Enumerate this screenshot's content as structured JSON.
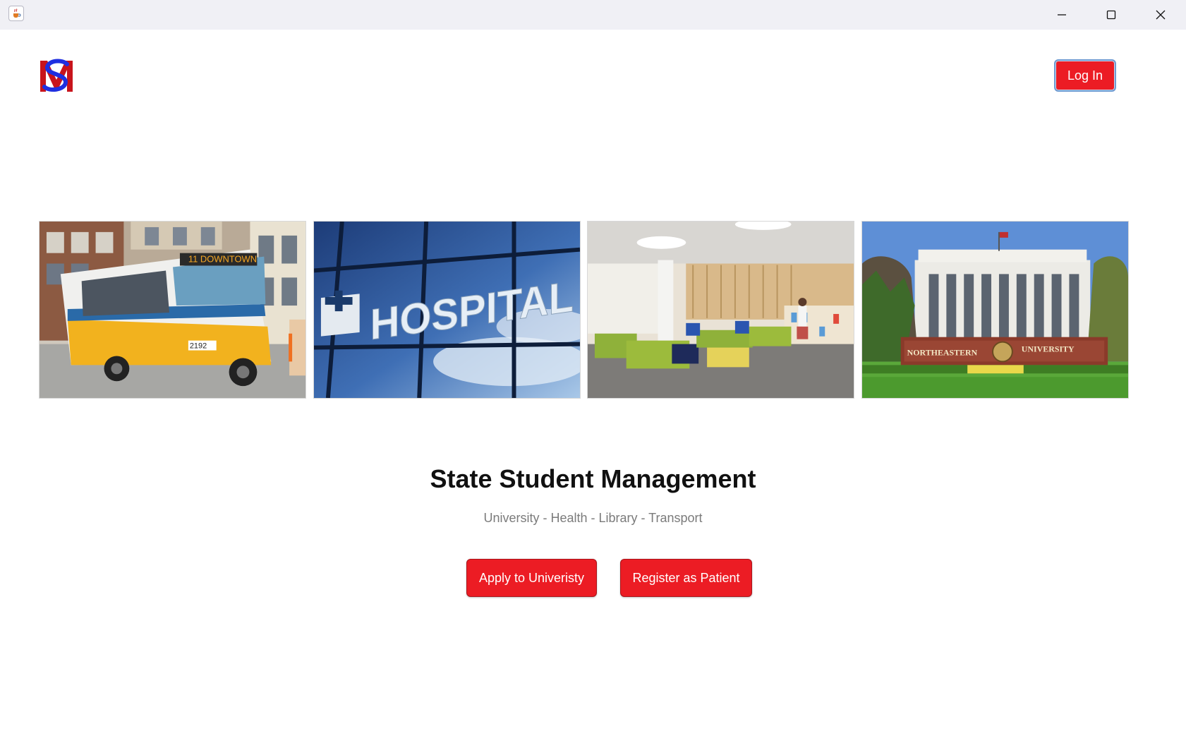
{
  "window": {
    "icon": "java-cup-icon",
    "controls": [
      "minimize-icon",
      "maximize-icon",
      "close-icon"
    ]
  },
  "header": {
    "logo_letters": "SM",
    "login_label": "Log In"
  },
  "gallery": {
    "tiles": [
      {
        "name": "bus",
        "sign": "11 DOWNTOWN",
        "number": "2192"
      },
      {
        "name": "hospital",
        "sign": "HOSPITAL"
      },
      {
        "name": "library"
      },
      {
        "name": "university",
        "sign_left": "NORTHEASTERN",
        "sign_right": "UNIVERSITY"
      }
    ]
  },
  "main": {
    "title": "State Student Management",
    "subtitle": "University - Health - Library - Transport",
    "apply_label": "Apply to Univeristy",
    "register_label": "Register as Patient"
  },
  "colors": {
    "accent": "#ec1c24",
    "logo_blue": "#1f2fe0",
    "titlebar": "#f0f0f5"
  }
}
